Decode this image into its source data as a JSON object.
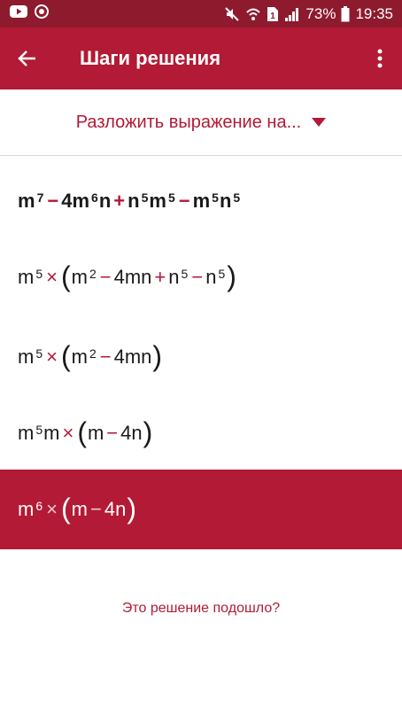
{
  "status_bar": {
    "battery": "73%",
    "time": "19:35",
    "icons": [
      "youtube-icon",
      "app-notify-icon",
      "mute-icon",
      "wifi-icon",
      "sim-icon",
      "signal-icon",
      "battery-icon"
    ]
  },
  "header": {
    "title": "Шаги решения",
    "back_icon": "arrow-left-icon",
    "menu_icon": "more-vert-icon"
  },
  "method_selector": {
    "label": "Разложить выражение на...",
    "icon": "dropdown-triangle-icon"
  },
  "steps": [
    {
      "tokens": [
        {
          "base": "m",
          "exp": "7"
        },
        {
          "op": "−"
        },
        {
          "base": "4m",
          "exp": "6"
        },
        {
          "base": "n"
        },
        {
          "op": "+"
        },
        {
          "base": "n",
          "exp": "5"
        },
        {
          "base": "m",
          "exp": "5"
        },
        {
          "op": "−"
        },
        {
          "base": "m",
          "exp": "5"
        },
        {
          "base": "n",
          "exp": "5"
        }
      ]
    },
    {
      "tokens": [
        {
          "base": "m",
          "exp": "5"
        },
        {
          "op": "×"
        },
        {
          "paren": "("
        },
        {
          "base": "m",
          "exp": "2"
        },
        {
          "op": "−"
        },
        {
          "base": "4mn"
        },
        {
          "op": "+"
        },
        {
          "base": "n",
          "exp": "5"
        },
        {
          "op": "−"
        },
        {
          "base": "n",
          "exp": "5"
        },
        {
          "paren": ")"
        }
      ]
    },
    {
      "tokens": [
        {
          "base": "m",
          "exp": "5"
        },
        {
          "op": "×"
        },
        {
          "paren": "("
        },
        {
          "base": "m",
          "exp": "2"
        },
        {
          "op": "−"
        },
        {
          "base": "4mn"
        },
        {
          "paren": ")"
        }
      ]
    },
    {
      "tokens": [
        {
          "base": "m",
          "exp": "5"
        },
        {
          "base": "m"
        },
        {
          "op": "×"
        },
        {
          "paren": "("
        },
        {
          "base": "m"
        },
        {
          "op": "−"
        },
        {
          "base": "4n"
        },
        {
          "paren": ")"
        }
      ]
    },
    {
      "tokens": [
        {
          "base": "m",
          "exp": "6"
        },
        {
          "op": "×"
        },
        {
          "paren": "("
        },
        {
          "base": "m"
        },
        {
          "op": "−"
        },
        {
          "base": "4n"
        },
        {
          "paren": ")"
        }
      ]
    }
  ],
  "feedback_link": "Это решение подошло?",
  "colors": {
    "brand": "#b21a35",
    "status_bar": "#8e1a2e",
    "text": "#1a1a1a"
  }
}
